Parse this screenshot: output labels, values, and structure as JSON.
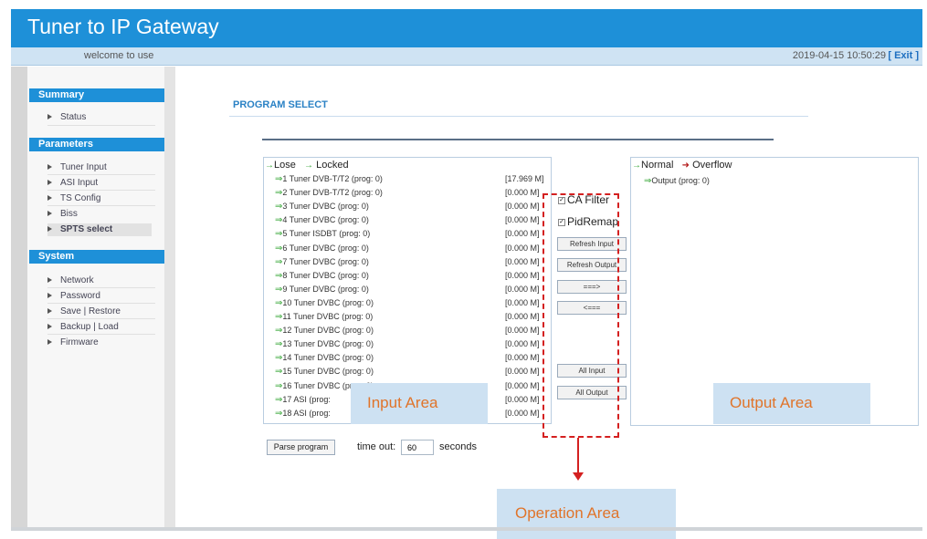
{
  "app": {
    "title": "Tuner to IP Gateway",
    "welcome": "welcome to use",
    "datetime": "2019-04-15 10:50:29",
    "exit_label": "[ Exit ]"
  },
  "sidebar": {
    "summary": {
      "title": "Summary",
      "items": [
        "Status"
      ]
    },
    "parameters": {
      "title": "Parameters",
      "items": [
        "Tuner Input",
        "ASI Input",
        "TS Config",
        "Biss",
        "SPTS select"
      ],
      "active": "SPTS select"
    },
    "system": {
      "title": "System",
      "items": [
        "Network",
        "Password",
        "Save | Restore",
        "Backup | Load",
        "Firmware"
      ]
    }
  },
  "main": {
    "page_title": "PROGRAM SELECT",
    "input_panel": {
      "legend_lose": "Lose",
      "legend_locked": "Locked",
      "rows": [
        {
          "name": "1 Tuner DVB-T/T2 (prog: 0)",
          "rate": "[17.969 M]"
        },
        {
          "name": "2 Tuner DVB-T/T2 (prog: 0)",
          "rate": "[0.000 M]"
        },
        {
          "name": "3 Tuner DVBC (prog: 0)",
          "rate": "[0.000 M]"
        },
        {
          "name": "4 Tuner DVBC (prog: 0)",
          "rate": "[0.000 M]"
        },
        {
          "name": "5 Tuner ISDBT (prog: 0)",
          "rate": "[0.000 M]"
        },
        {
          "name": "6 Tuner DVBC (prog: 0)",
          "rate": "[0.000 M]"
        },
        {
          "name": "7 Tuner DVBC (prog: 0)",
          "rate": "[0.000 M]"
        },
        {
          "name": "8 Tuner DVBC (prog: 0)",
          "rate": "[0.000 M]"
        },
        {
          "name": "9 Tuner DVBC (prog: 0)",
          "rate": "[0.000 M]"
        },
        {
          "name": "10 Tuner DVBC (prog: 0)",
          "rate": "[0.000 M]"
        },
        {
          "name": "11 Tuner DVBC (prog: 0)",
          "rate": "[0.000 M]"
        },
        {
          "name": "12 Tuner DVBC (prog: 0)",
          "rate": "[0.000 M]"
        },
        {
          "name": "13 Tuner DVBC (prog: 0)",
          "rate": "[0.000 M]"
        },
        {
          "name": "14 Tuner DVBC (prog: 0)",
          "rate": "[0.000 M]"
        },
        {
          "name": "15 Tuner DVBC (prog: 0)",
          "rate": "[0.000 M]"
        },
        {
          "name": "16 Tuner DVBC (prog: 0)",
          "rate": "[0.000 M]"
        },
        {
          "name": "17 ASI (prog:",
          "rate": "[0.000 M]"
        },
        {
          "name": "18 ASI (prog:",
          "rate": "[0.000 M]"
        }
      ],
      "area_label": "Input Area"
    },
    "operation": {
      "ca_filter": "CA Filter",
      "pid_remap": "PidRemap",
      "buttons": [
        "Refresh Input",
        "Refresh Output",
        "===>",
        "<===",
        "All Input",
        "All Output"
      ],
      "area_label": "Operation Area"
    },
    "output_panel": {
      "legend_normal": "Normal",
      "legend_overflow": "Overflow",
      "output_item": "Output (prog: 0)",
      "area_label": "Output Area"
    },
    "parse_button": "Parse program",
    "timeout_label": "time out:",
    "timeout_value": "60",
    "seconds_label": "seconds"
  },
  "colors": {
    "header": "#1e90d8",
    "accent_orange": "#e0742a",
    "dash_red": "#d42020",
    "label_bg": "#cde1f2"
  }
}
